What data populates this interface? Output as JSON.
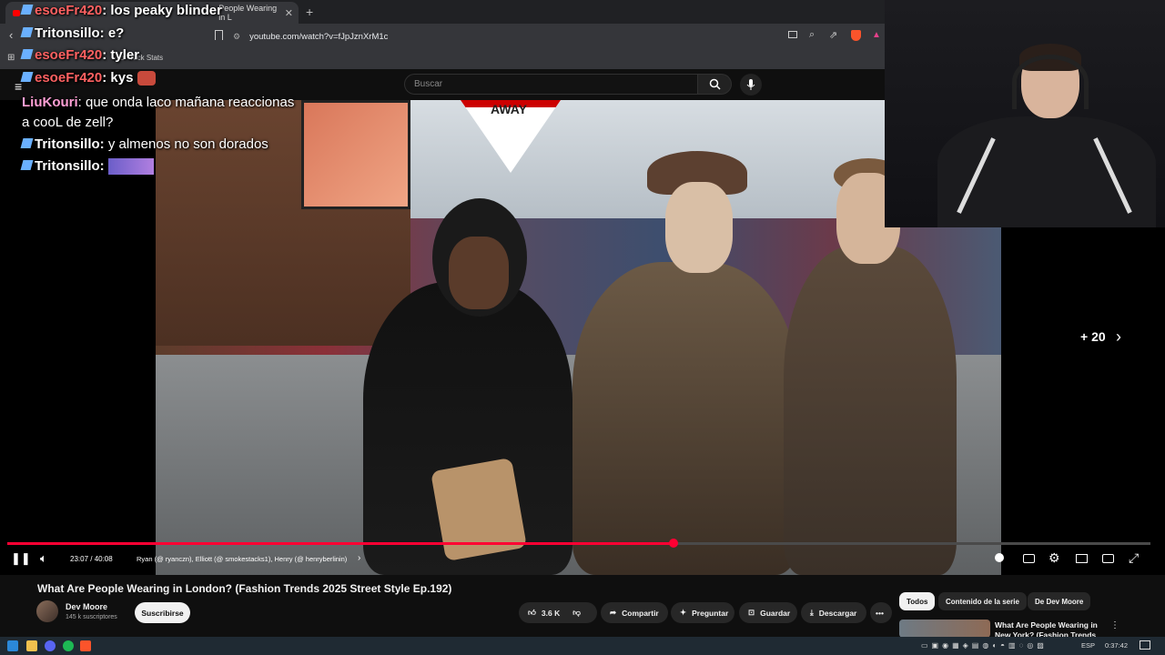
{
  "browser": {
    "tab_title": "People Wearing in L",
    "url": "youtube.com/watch?v=fJpJznXrM1c",
    "bookmark": "o - Kick Stats"
  },
  "youtube": {
    "search_placeholder": "Buscar"
  },
  "chat": [
    {
      "user": "esoeFr420",
      "message": "los peaky blinder",
      "color": "#ff6161"
    },
    {
      "user": "Tritonsillo",
      "message": "e?",
      "color": "#ffffff"
    },
    {
      "user": "esoeFr420",
      "message": "tyler",
      "color": "#ff6161"
    },
    {
      "user": "esoeFr420",
      "message": "kys",
      "color": "#ff6161"
    },
    {
      "user": "LiuKouri",
      "message": "que onda laco mañana reaccionas",
      "color": "#ff9fd5"
    },
    {
      "user": "",
      "message": "a cooL de zell?",
      "color": "#ffffff"
    },
    {
      "user": "Tritonsillo",
      "message": "y almenos no son dorados",
      "color": "#ffffff"
    },
    {
      "user": "Tritonsillo",
      "message": "",
      "color": "#ffffff"
    }
  ],
  "video": {
    "sign_text": "AWAY",
    "more_count": "+ 20",
    "time": "23:07 / 40:08",
    "chapter": "Ryan (@ ryanczn), Elliott (@ smokestacks1), Henry (@ henryberlinin)",
    "progress_fraction": 0.583
  },
  "meta": {
    "title": "What Are People Wearing in London? (Fashion Trends 2025 Street Style Ep.192)",
    "channel": "Dev Moore",
    "subscribers": "145 k suscriptores",
    "subscribe": "Suscribirse",
    "likes": "3.6 K",
    "share": "Compartir",
    "ask": "Preguntar",
    "save": "Guardar",
    "download": "Descargar"
  },
  "chips": [
    "Todos",
    "Contenido de la serie",
    "De Dev Moore"
  ],
  "recommendation": {
    "title": "What Are People Wearing in New York? (Fashion Trends"
  },
  "taskbar": {
    "lang": "ESP",
    "clock": "0:37:42"
  }
}
